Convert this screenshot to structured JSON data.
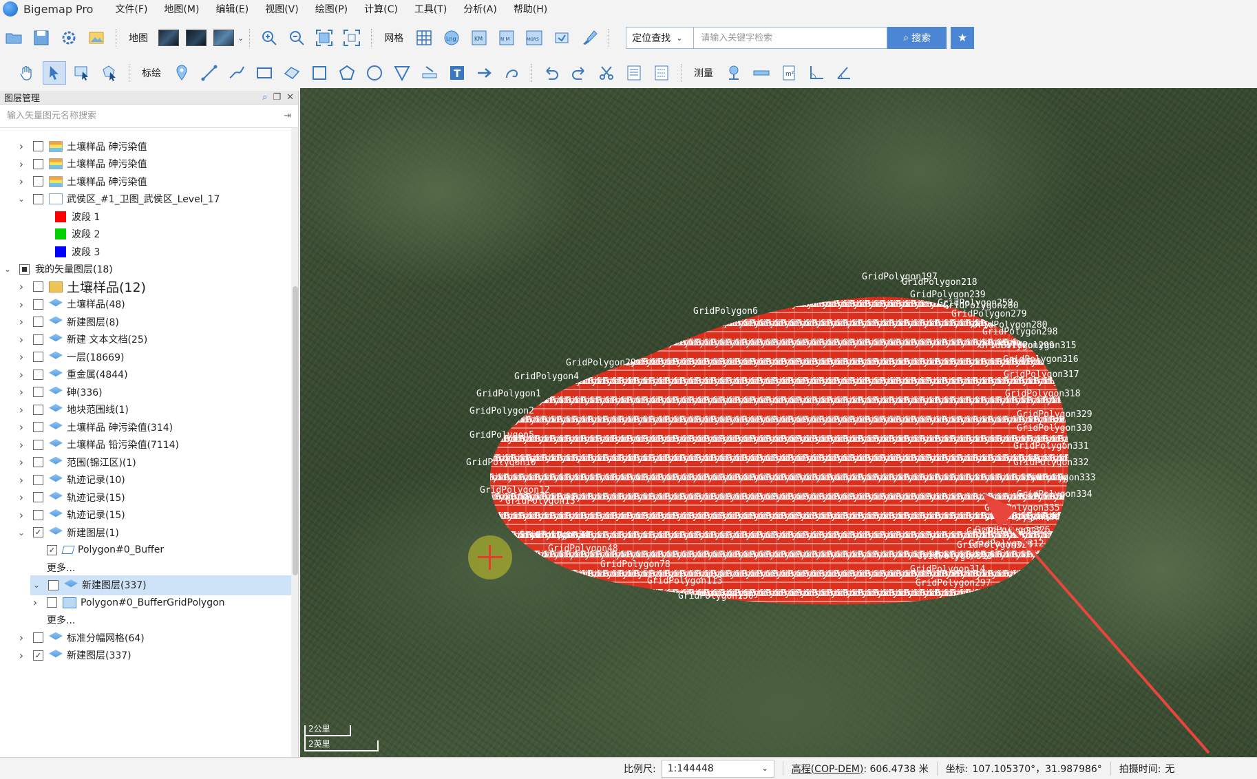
{
  "app": {
    "title": "Bigemap Pro"
  },
  "menu": [
    "文件(F)",
    "地图(M)",
    "编辑(E)",
    "视图(V)",
    "绘图(P)",
    "计算(C)",
    "工具(T)",
    "分析(A)",
    "帮助(H)"
  ],
  "toolbar1": {
    "map_label": "地图",
    "grid_label": "网格",
    "locate_label": "定位查找",
    "search_placeholder": "请输入关键字检索",
    "search_button": "搜索",
    "icon_labels": {
      "lng": "Lng",
      "km": "KM",
      "nm": "N M",
      "mgrs": "MGRS"
    }
  },
  "toolbar2": {
    "draw_label": "标绘",
    "measure_label": "测量",
    "text_tool": "T",
    "area_unit": "m²"
  },
  "panel": {
    "title": "图层管理",
    "search_placeholder": "输入矢量图元名称搜索",
    "rows": [
      {
        "label": "土壤样品 砷污染值",
        "arrow": ">",
        "check": "off",
        "icon": "raster",
        "indent": 0
      },
      {
        "label": "土壤样品 砷污染值",
        "arrow": ">",
        "check": "off",
        "icon": "raster",
        "indent": 0
      },
      {
        "label": "土壤样品 砷污染值",
        "arrow": ">",
        "check": "off",
        "icon": "raster",
        "indent": 0
      },
      {
        "label": "武侯区_#1_卫图_武侯区_Level_17",
        "arrow": "v",
        "check": "off",
        "icon": "image",
        "indent": 0
      },
      {
        "label": "波段 1",
        "swatch": "#ff0000",
        "indent": 1
      },
      {
        "label": "波段 2",
        "swatch": "#00d000",
        "indent": 1
      },
      {
        "label": "波段 3",
        "swatch": "#0000ff",
        "indent": 1
      },
      {
        "label": "我的矢量图层(18)",
        "arrow": "v",
        "check": "partial",
        "indent": -1
      },
      {
        "label": "土壤样品(12)",
        "arrow": ">",
        "check": "off",
        "icon": "folder",
        "indent": 0,
        "big": true
      },
      {
        "label": "土壤样品(48)",
        "arrow": ">",
        "check": "off",
        "icon": "layers",
        "indent": 0
      },
      {
        "label": "新建图层(8)",
        "arrow": ">",
        "check": "off",
        "icon": "layers",
        "indent": 0
      },
      {
        "label": "新建 文本文档(25)",
        "arrow": ">",
        "check": "off",
        "icon": "layers",
        "indent": 0
      },
      {
        "label": "一层(18669)",
        "arrow": ">",
        "check": "off",
        "icon": "layers",
        "indent": 0
      },
      {
        "label": "重金属(4844)",
        "arrow": ">",
        "check": "off",
        "icon": "layers",
        "indent": 0
      },
      {
        "label": "砷(336)",
        "arrow": ">",
        "check": "off",
        "icon": "layers",
        "indent": 0
      },
      {
        "label": "地块范围线(1)",
        "arrow": ">",
        "check": "off",
        "icon": "layers",
        "indent": 0
      },
      {
        "label": "土壤样品 砷污染值(314)",
        "arrow": ">",
        "check": "off",
        "icon": "layers",
        "indent": 0
      },
      {
        "label": "土壤样品 铅污染值(7114)",
        "arrow": ">",
        "check": "off",
        "icon": "layers",
        "indent": 0
      },
      {
        "label": "范围(锦江区)(1)",
        "arrow": ">",
        "check": "off",
        "icon": "layers",
        "indent": 0
      },
      {
        "label": "轨迹记录(10)",
        "arrow": ">",
        "check": "off",
        "icon": "layers",
        "indent": 0
      },
      {
        "label": "轨迹记录(15)",
        "arrow": ">",
        "check": "off",
        "icon": "layers",
        "indent": 0
      },
      {
        "label": "轨迹记录(15)",
        "arrow": ">",
        "check": "off",
        "icon": "layers",
        "indent": 0
      },
      {
        "label": "新建图层(1)",
        "arrow": "v",
        "check": "on",
        "icon": "layers",
        "indent": 0
      },
      {
        "label": "Polygon#0_Buffer",
        "check": "on",
        "icon": "poly",
        "indent": 1
      },
      {
        "label": "更多...",
        "indent": 1,
        "plain": true
      },
      {
        "label": "新建图层(337)",
        "arrow": "v",
        "check": "off",
        "icon": "layers",
        "indent": 0,
        "selected": true
      },
      {
        "label": "Polygon#0_BufferGridPolygon",
        "arrow": ">",
        "check": "off",
        "icon": "grid",
        "indent": 1
      },
      {
        "label": "更多...",
        "indent": 1,
        "plain": true
      },
      {
        "label": "标准分幅网格(64)",
        "arrow": ">",
        "check": "off",
        "icon": "layers",
        "indent": 0
      },
      {
        "label": "新建图层(337)",
        "arrow": ">",
        "check": "on",
        "icon": "layers",
        "indent": 0
      }
    ]
  },
  "map": {
    "label_prefix": "GridP",
    "edge_labels": [
      "GridPolygon197",
      "GridPolygon218",
      "GridPolygon239",
      "GridPolygon259",
      "GridPolygon279",
      "GridPolygon260",
      "GridPolygon280",
      "GridPolygon298",
      "GridPolygon299",
      "GridPolygon315",
      "GridPolygon316",
      "GridPolygon317",
      "GridPolygon318",
      "GridPolygon329",
      "GridPolygon330",
      "GridPolygon331",
      "GridPolygon332",
      "GridPolygon333",
      "GridPolygon334",
      "GridPolygon335",
      "GridPolygon336",
      "GridPolygon327",
      "GridPolygon328",
      "GridPolygon313",
      "GridPolygon314",
      "GridPolygon297",
      "GridPolygon312",
      "GridPolygon326",
      "GridPolygon12",
      "GridPolygon34",
      "GridPolygon48",
      "GridPolygon78",
      "GridPolygon113",
      "GridPolygon130",
      "GridPolygon13",
      "GridPolygon6",
      "GridPolygon29",
      "GridPolygon4",
      "GridPolygon1",
      "GridPolygon2",
      "GridPolygon5",
      "GridPolygon10"
    ],
    "scale_metric": "2公里",
    "scale_imperial": "2英里",
    "overlay_color": "#ff2a1a",
    "arrow_color": "#e8453c"
  },
  "status": {
    "scale_label": "比例尺:",
    "scale_value": "1:144448",
    "elev_label": "高程(COP-DEM)",
    "elev_value": ": 606.4738 米",
    "coord_label": "坐标:",
    "coord_value": "107.105370°，31.987986°",
    "shot_label": "拍摄时间:",
    "shot_value": "无"
  }
}
